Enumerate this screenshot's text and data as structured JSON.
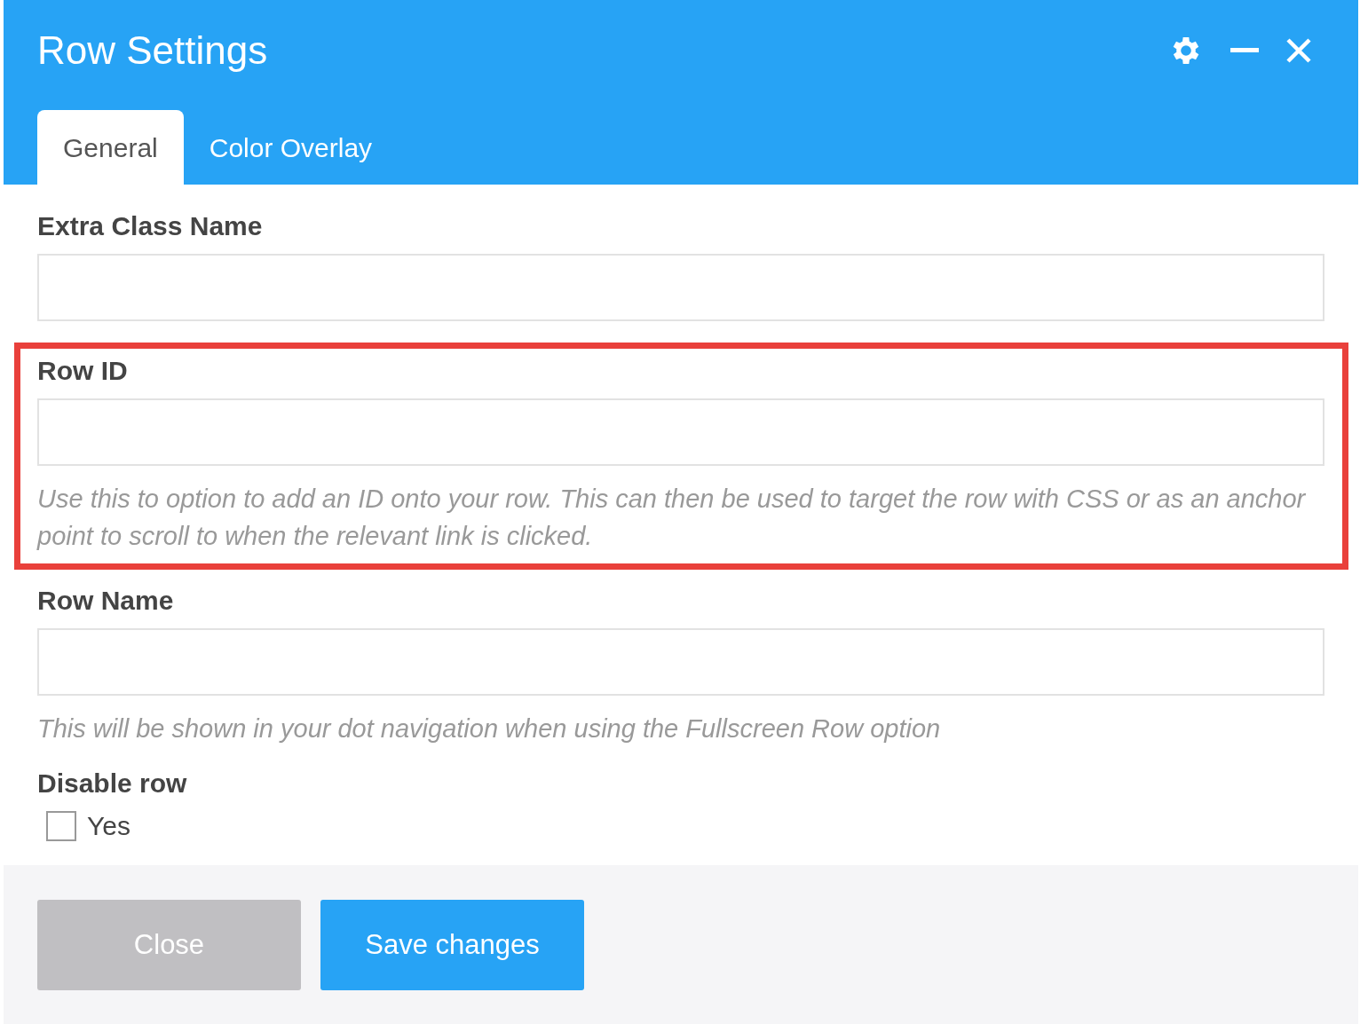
{
  "window": {
    "title": "Row Settings"
  },
  "tabs": [
    {
      "label": "General",
      "selected": true
    },
    {
      "label": "Color Overlay",
      "selected": false
    }
  ],
  "fields": [
    {
      "kind": "text",
      "label": "Extra Class Name",
      "highlighted": false
    },
    {
      "kind": "text",
      "label": "Row ID",
      "help": "Use this to option to add an ID onto your row. This can then be used to target the row with CSS or as an anchor point to scroll to when the relevant link is clicked.",
      "highlighted": true
    },
    {
      "kind": "text",
      "label": "Row Name",
      "help": "This will be shown in your dot navigation when using the Fullscreen Row option",
      "highlighted": false
    },
    {
      "kind": "checkbox",
      "label": "Disable row",
      "option": "Yes",
      "checked": false,
      "highlighted": false
    }
  ],
  "buttons": [
    {
      "label": "Close",
      "kind": "secondary"
    },
    {
      "label": "Save changes",
      "kind": "primary"
    }
  ]
}
